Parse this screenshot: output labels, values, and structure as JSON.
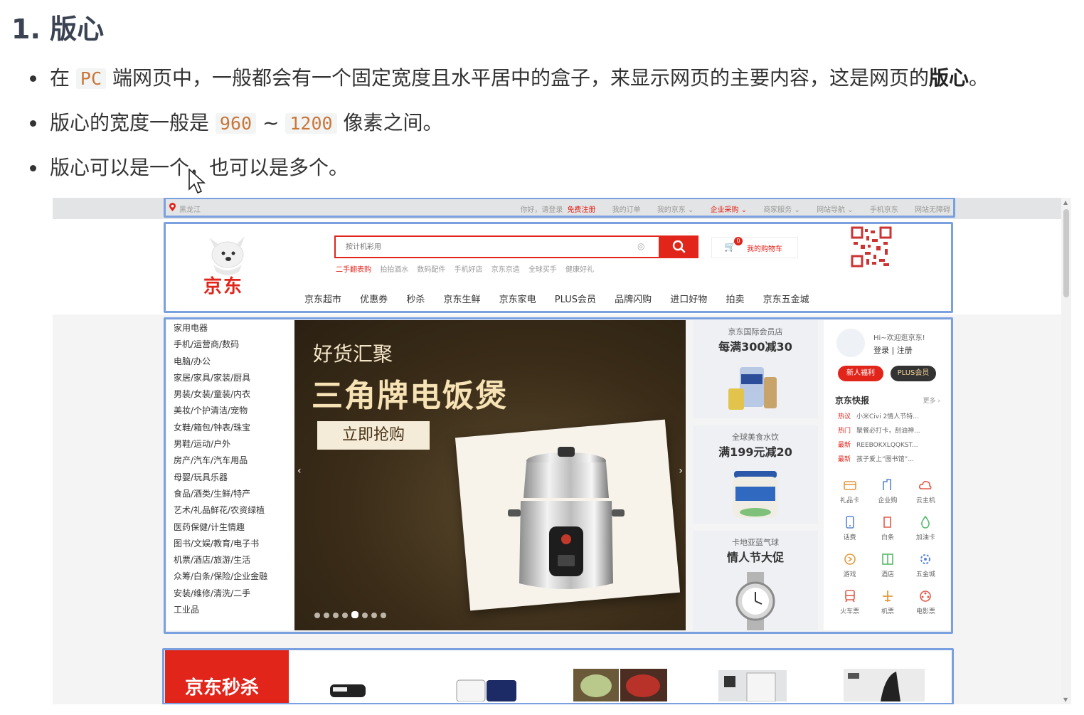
{
  "doc": {
    "title": "1. 版心",
    "b1_a": "在",
    "b1_code": "PC",
    "b1_b": "端网页中，一般都会有一个固定宽度且水平居中的盒子，来显示网页的主要内容，这是网页的",
    "b1_strong": "版心",
    "b1_c": "。",
    "b2_a": "版心的宽度一般是",
    "b2_code1": "960",
    "b2_sep": "~",
    "b2_code2": "1200",
    "b2_b": "像素之间。",
    "b3": "版心可以是一个，也可以是多个。"
  },
  "site": {
    "location": "黑龙江",
    "greeting": "你好，请登录",
    "register": "免费注册",
    "top_links": [
      "我的订单",
      "我的京东 ⌄",
      "企业采购 ⌄",
      "商家服务 ⌄",
      "网站导航 ⌄",
      "手机京东",
      "网站无障碍"
    ],
    "logo_text": "京东",
    "search_placeholder": "按计机彩用",
    "hot_first": "二手翻表购",
    "hot_words": [
      "拍拍酒水",
      "数码配件",
      "手机好店",
      "京东京造",
      "全球买手",
      "健康好礼"
    ],
    "cart_count": "0",
    "cart_label": "我的购物车",
    "nav": [
      "京东超市",
      "优惠券",
      "秒杀",
      "京东生鲜",
      "京东家电",
      "PLUS会员",
      "品牌闪购",
      "进口好物",
      "拍卖",
      "京东五金城"
    ],
    "categories": [
      "家用电器",
      "手机/运营商/数码",
      "电脑/办公",
      "家居/家具/家装/厨具",
      "男装/女装/童装/内衣",
      "美妆/个护清洁/宠物",
      "女鞋/箱包/钟表/珠宝",
      "男鞋/运动/户外",
      "房产/汽车/汽车用品",
      "母婴/玩具乐器",
      "食品/酒类/生鲜/特产",
      "艺术/礼品鲜花/农资绿植",
      "医药保健/计生情趣",
      "图书/文娱/教育/电子书",
      "机票/酒店/旅游/生活",
      "众筹/白条/保险/企业金融",
      "安装/维修/清洗/二手",
      "工业品"
    ],
    "banner": {
      "subtitle": "好货汇聚",
      "title": "三角牌电饭煲",
      "button": "立即抢购"
    },
    "promos": [
      {
        "line1": "京东国际会员店",
        "line2": "每满300减30"
      },
      {
        "line1": "全球美食水饮",
        "line2": "满199元减20"
      },
      {
        "line1": "卡地亚蓝气球",
        "line2": "情人节大促"
      }
    ],
    "user": {
      "hi": "Hi~欢迎逛京东!",
      "login": "登录 | 注册",
      "btn_new": "新人福利",
      "btn_plus": "PLUS会员",
      "news_title": "京东快报",
      "news_more": "更多 ›",
      "news": [
        {
          "tag": "热议",
          "text": "小米Civi 2情人节特..."
        },
        {
          "tag": "热门",
          "text": "聚餐必打卡，刮油神..."
        },
        {
          "tag": "最新",
          "text": "REEBOKXLQQKST..."
        },
        {
          "tag": "最新",
          "text": "孩子爱上“图书馆”..."
        }
      ],
      "services": [
        "礼品卡",
        "企业购",
        "云主机",
        "话费",
        "白条",
        "加油卡",
        "游戏",
        "酒店",
        "五金城",
        "火车票",
        "机票",
        "电影票"
      ]
    },
    "seckill": "京东秒杀"
  }
}
